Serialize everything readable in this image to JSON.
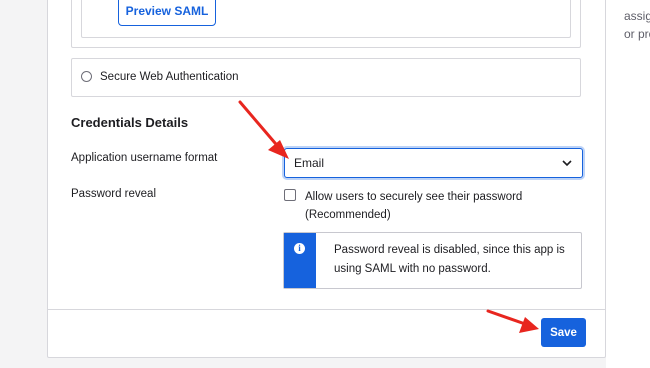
{
  "preview_button": {
    "label": "Preview SAML"
  },
  "swa_option": {
    "label": "Secure Web Authentication"
  },
  "credentials": {
    "title": "Credentials Details",
    "username_format": {
      "label": "Application username format",
      "selected_value": "Email"
    },
    "password_reveal": {
      "label": "Password reveal",
      "checkbox_label": "Allow users to securely see their password (Recommended)",
      "notice": "Password reveal is disabled, since this app is using SAML with no password.",
      "notice_icon": "info-icon"
    }
  },
  "footer": {
    "save_label": "Save"
  },
  "side_panel": {
    "line1": "assig",
    "line2": "or pro"
  },
  "colors": {
    "accent": "#1662dd",
    "annotation": "#e8261f"
  }
}
